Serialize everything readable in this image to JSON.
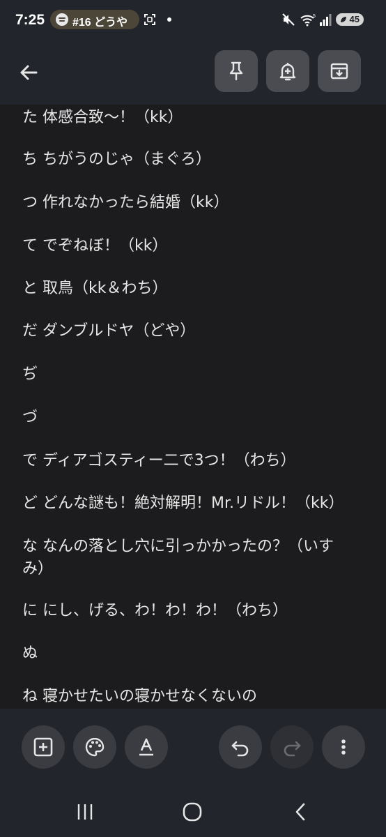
{
  "status_bar": {
    "time": "7:25",
    "media_pill_text": "#16 どうや",
    "battery_level": "45",
    "network_label": "5"
  },
  "app_bar": {
    "back_icon": "arrow-back-icon",
    "pin_icon": "pin-icon",
    "reminder_icon": "bell-plus-icon",
    "archive_icon": "archive-icon"
  },
  "note": {
    "lines": [
      "た 体感合致〜！（kk）",
      "ち ちがうのじゃ（まぐろ）",
      "つ 作れなかったら結婚（kk）",
      "て でぞねぼ！（kk）",
      "と 取鳥（kk＆わち）",
      "だ ダンブルドヤ（どや）",
      "ぢ",
      "づ",
      "で ディアゴスティー二で3つ！（わち）",
      "ど どんな謎も！絶対解明！Mr.リドル！（kk）",
      "な なんの落とし穴に引っかかったの？（いす",
      "み）",
      "に にし、げる、わ！わ！わ！（わち）",
      "ぬ",
      "ね 寝かせたいの寝かせなくないの"
    ]
  },
  "bottom_toolbar": {
    "add_icon": "add-box-icon",
    "palette_icon": "palette-icon",
    "text_format_icon": "text-format-icon",
    "undo_icon": "undo-icon",
    "redo_icon": "redo-icon",
    "more_icon": "more-vert-icon"
  },
  "colors": {
    "background": "#1c1c1e",
    "bar": "#22252b",
    "button": "#4a4c52",
    "text": "#e6e6e6"
  }
}
